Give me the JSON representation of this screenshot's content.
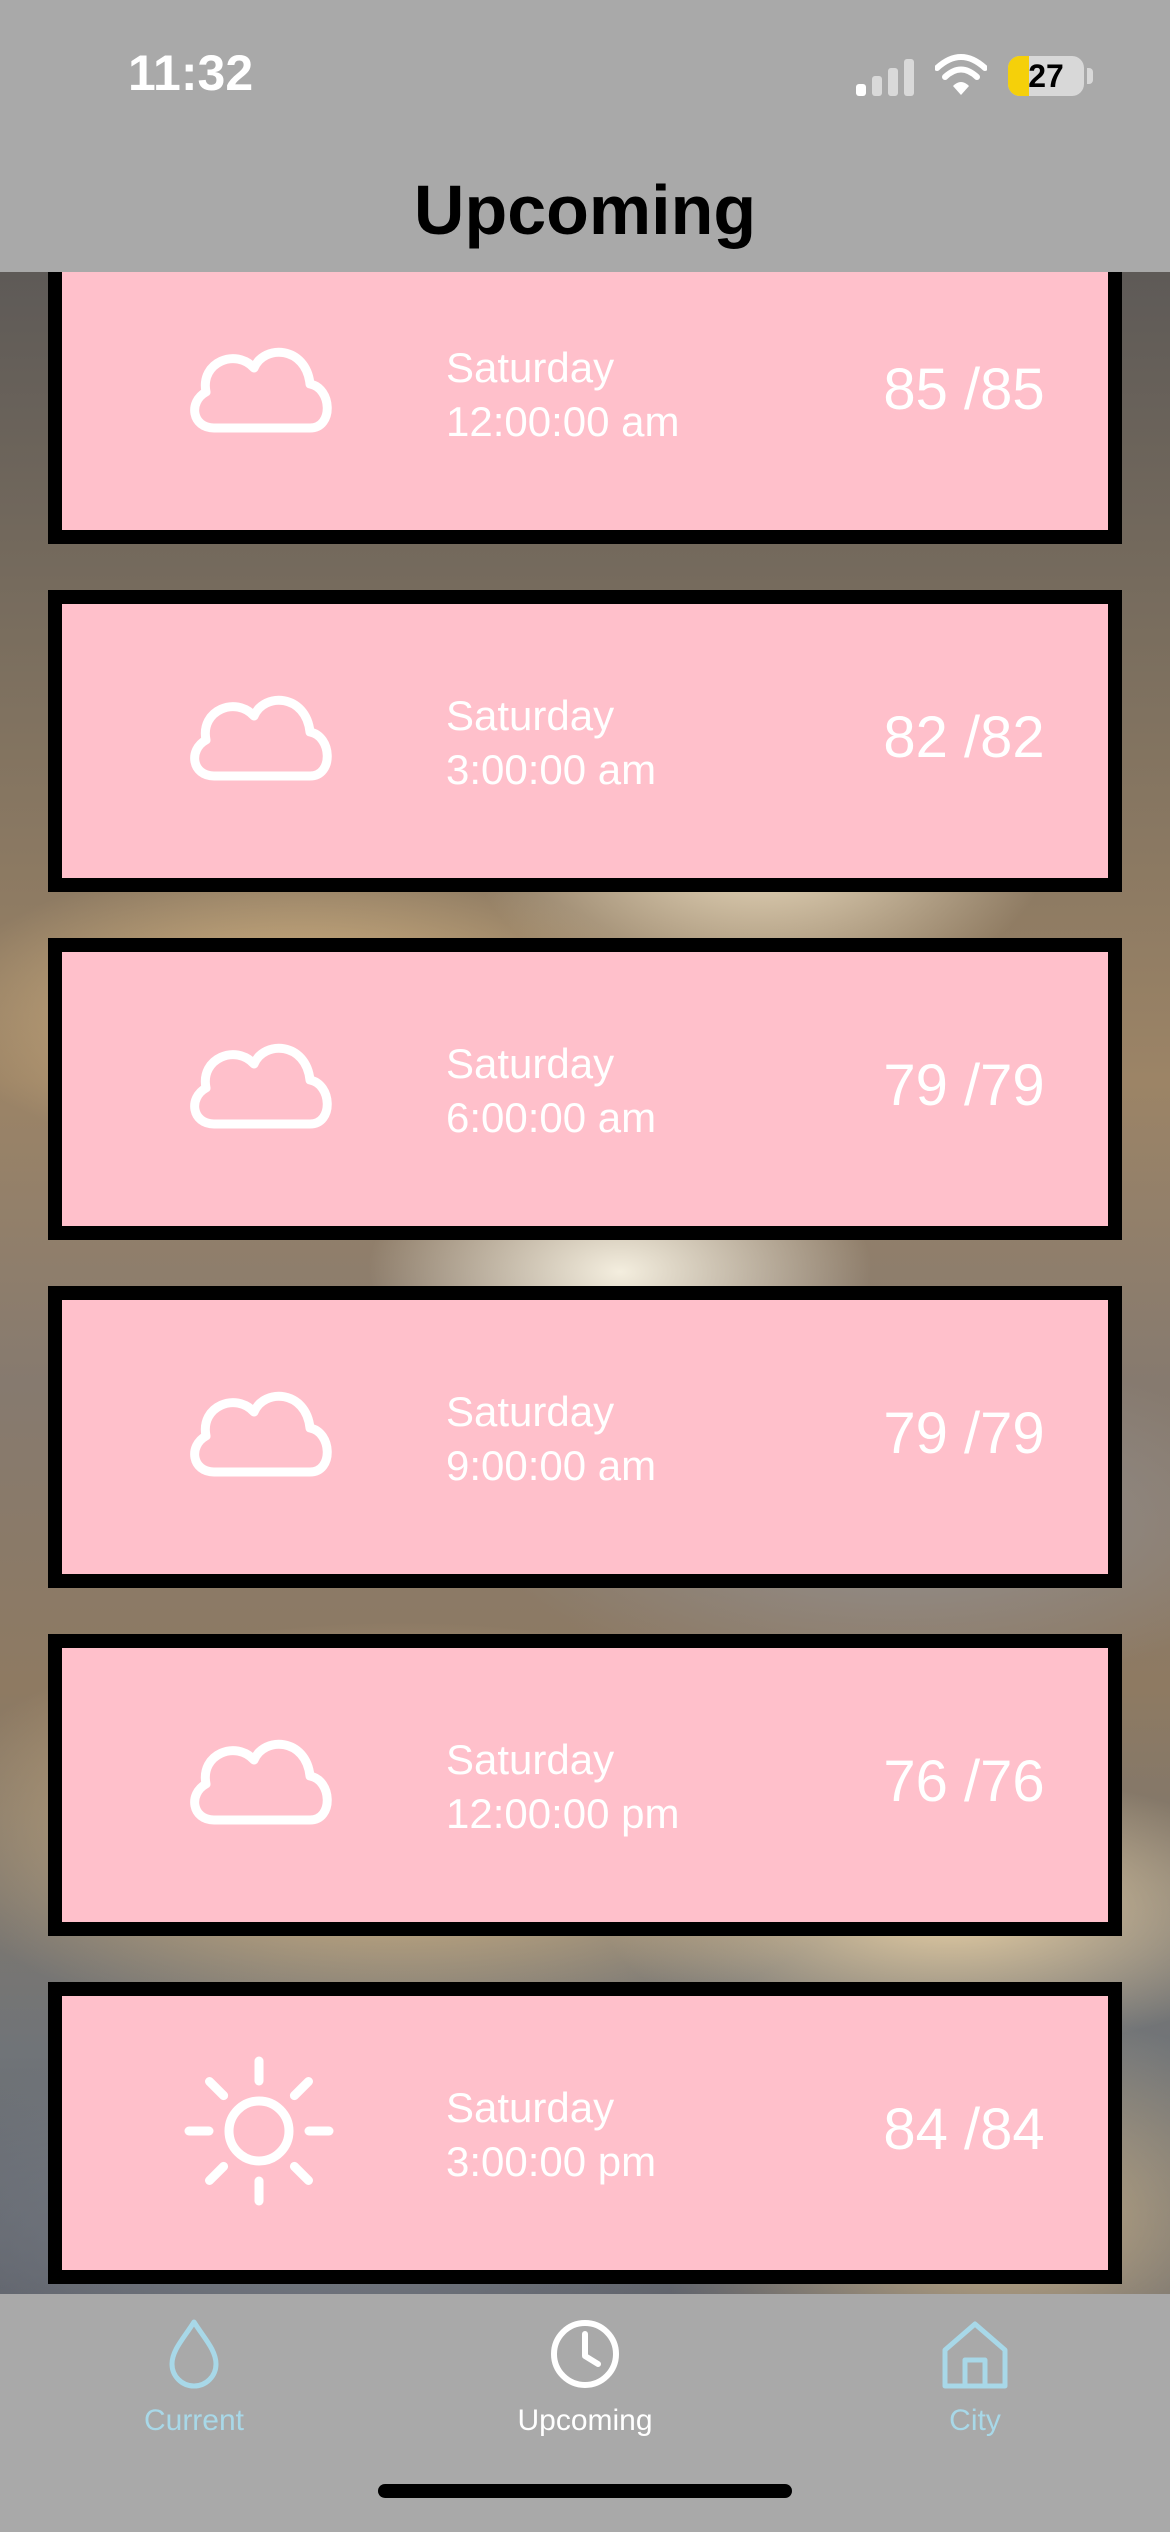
{
  "status_bar": {
    "time": "11:32",
    "battery_percent": 27,
    "battery_label": "27"
  },
  "header": {
    "title": "Upcoming"
  },
  "forecast": [
    {
      "icon": "cloud-icon",
      "day": "Saturday",
      "time": "12:00:00 am",
      "temp": "85 /85"
    },
    {
      "icon": "cloud-icon",
      "day": "Saturday",
      "time": "3:00:00 am",
      "temp": "82 /82"
    },
    {
      "icon": "cloud-icon",
      "day": "Saturday",
      "time": "6:00:00 am",
      "temp": "79 /79"
    },
    {
      "icon": "cloud-icon",
      "day": "Saturday",
      "time": "9:00:00 am",
      "temp": "79 /79"
    },
    {
      "icon": "cloud-icon",
      "day": "Saturday",
      "time": "12:00:00 pm",
      "temp": "76 /76"
    },
    {
      "icon": "sun-icon",
      "day": "Saturday",
      "time": "3:00:00 pm",
      "temp": "84 /84"
    }
  ],
  "tab_bar": {
    "tabs": [
      {
        "label": "Current",
        "icon": "drop-icon",
        "active": false
      },
      {
        "label": "Upcoming",
        "icon": "clock-icon",
        "active": true
      },
      {
        "label": "City",
        "icon": "house-icon",
        "active": false
      }
    ]
  },
  "colors": {
    "card_background": "#ffc0cb",
    "card_border": "#000000",
    "bar_background": "#a9a9a9",
    "tab_inactive": "#a8d8e8",
    "tab_active": "#ffffff"
  }
}
